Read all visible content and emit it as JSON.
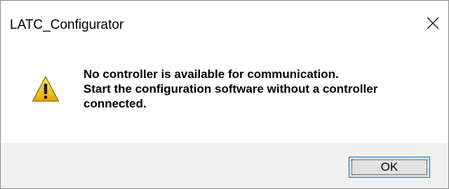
{
  "window": {
    "title": "LATC_Configurator"
  },
  "icons": {
    "close": "close-icon",
    "warning": "warning-icon"
  },
  "message": {
    "lines": [
      "No controller is available for communication.",
      "Start the configuration software without a controller",
      "connected."
    ]
  },
  "buttons": {
    "ok_label": "OK"
  },
  "colors": {
    "footer_bg": "#f0f0f0",
    "button_border": "#0078d7",
    "warning_yellow": "#f2c21a"
  }
}
